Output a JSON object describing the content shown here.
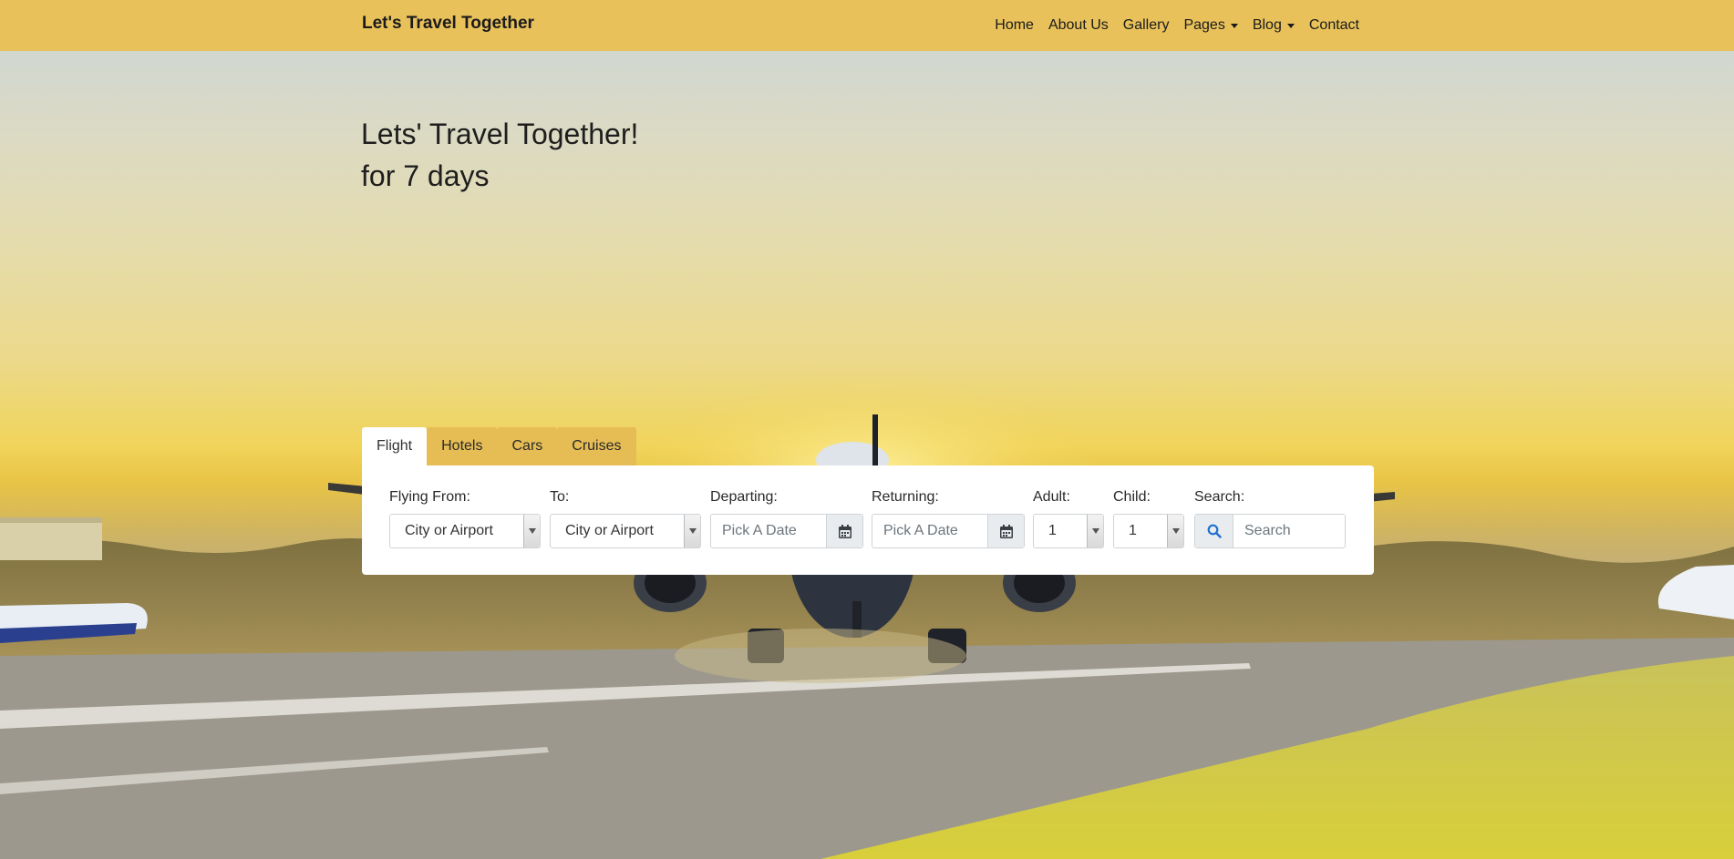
{
  "navbar": {
    "brand": "Let's Travel Together",
    "items": [
      {
        "label": "Home",
        "dropdown": false
      },
      {
        "label": "About Us",
        "dropdown": false
      },
      {
        "label": "Gallery",
        "dropdown": false
      },
      {
        "label": "Pages",
        "dropdown": true
      },
      {
        "label": "Blog",
        "dropdown": true
      },
      {
        "label": "Contact",
        "dropdown": false
      }
    ],
    "background_color": "#e8c15a"
  },
  "hero": {
    "line1": "Lets' Travel Together!",
    "line2": "for 7 days"
  },
  "booking": {
    "tabs": [
      {
        "label": "Flight",
        "active": true
      },
      {
        "label": "Hotels",
        "active": false
      },
      {
        "label": "Cars",
        "active": false
      },
      {
        "label": "Cruises",
        "active": false
      }
    ],
    "fields": {
      "from": {
        "label": "Flying From:",
        "value": "City or Airport"
      },
      "to": {
        "label": "To:",
        "value": "City or Airport"
      },
      "departing": {
        "label": "Departing:",
        "placeholder": "Pick A Date"
      },
      "returning": {
        "label": "Returning:",
        "placeholder": "Pick A Date"
      },
      "adult": {
        "label": "Adult:",
        "value": "1"
      },
      "child": {
        "label": "Child:",
        "value": "1"
      },
      "search": {
        "label": "Search:",
        "placeholder": "Search"
      }
    }
  },
  "icons": {
    "search": "search-icon",
    "calendar": "calendar-icon",
    "caret": "caret-down-icon"
  },
  "colors": {
    "accent": "#e8c15a",
    "tab_inactive": "#e6bd55",
    "search_icon": "#1f6fd1"
  }
}
